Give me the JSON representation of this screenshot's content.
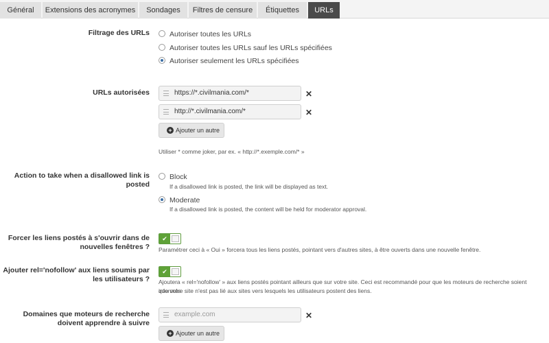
{
  "tabs": [
    {
      "label": "Général"
    },
    {
      "label": "Extensions des acronymes"
    },
    {
      "label": "Sondages"
    },
    {
      "label": "Filtres de censure"
    },
    {
      "label": "Étiquettes"
    },
    {
      "label": "URLs",
      "active": true
    }
  ],
  "url_filtering": {
    "label": "Filtrage des URLs",
    "options": [
      {
        "label": "Autoriser toutes les URLs",
        "checked": false
      },
      {
        "label": "Autoriser toutes les URLs sauf les URLs spécifiées",
        "checked": false
      },
      {
        "label": "Autoriser seulement les URLs spécifiées",
        "checked": true
      }
    ]
  },
  "allowed_urls": {
    "label": "URLs autorisées",
    "items": [
      "https://*.civilmania.com/*",
      "http://*.civilmania.com/*"
    ],
    "add_label": "Ajouter un autre",
    "help": "Utiliser * comme joker, par ex. « http://*.exemple.com/* »",
    "remove_icon": "times-icon"
  },
  "disallowed_action": {
    "label": "Action to take when a disallowed link is posted",
    "options": [
      {
        "label": "Block",
        "checked": false,
        "help": "If a disallowed link is posted, the link will be displayed as text."
      },
      {
        "label": "Moderate",
        "checked": true,
        "help": "If a disallowed link is posted, the content will be held for moderator approval."
      }
    ]
  },
  "force_new_window": {
    "label": "Forcer les liens postés à s'ouvrir dans de nouvelles fenêtres ?",
    "enabled": true,
    "help": "Paramétrer ceci à « Oui » forcera tous les liens postés, pointant vers d'autres sites, à être ouverts dans une nouvelle fenêtre."
  },
  "nofollow": {
    "label": "Ajouter rel='nofollow' aux liens soumis par les utilisateurs ?",
    "enabled": true,
    "help_line1": "Ajoutera « rel='nofollow' » aux liens postés pointant ailleurs que sur votre site. Ceci est recommandé pour que les moteurs de recherche soient informés",
    "help_line2": "que votre site n'est pas lié aux sites vers lesquels les utilisateurs postent des liens."
  },
  "follow_domains": {
    "label": "Domaines que moteurs de recherche doivent apprendre à suivre",
    "placeholder": "example.com",
    "add_label": "Ajouter un autre"
  },
  "colors": {
    "active_tab": "#4a4a4a",
    "toggle_on": "#5fa238",
    "radio_checked": "#3a6ea5"
  }
}
